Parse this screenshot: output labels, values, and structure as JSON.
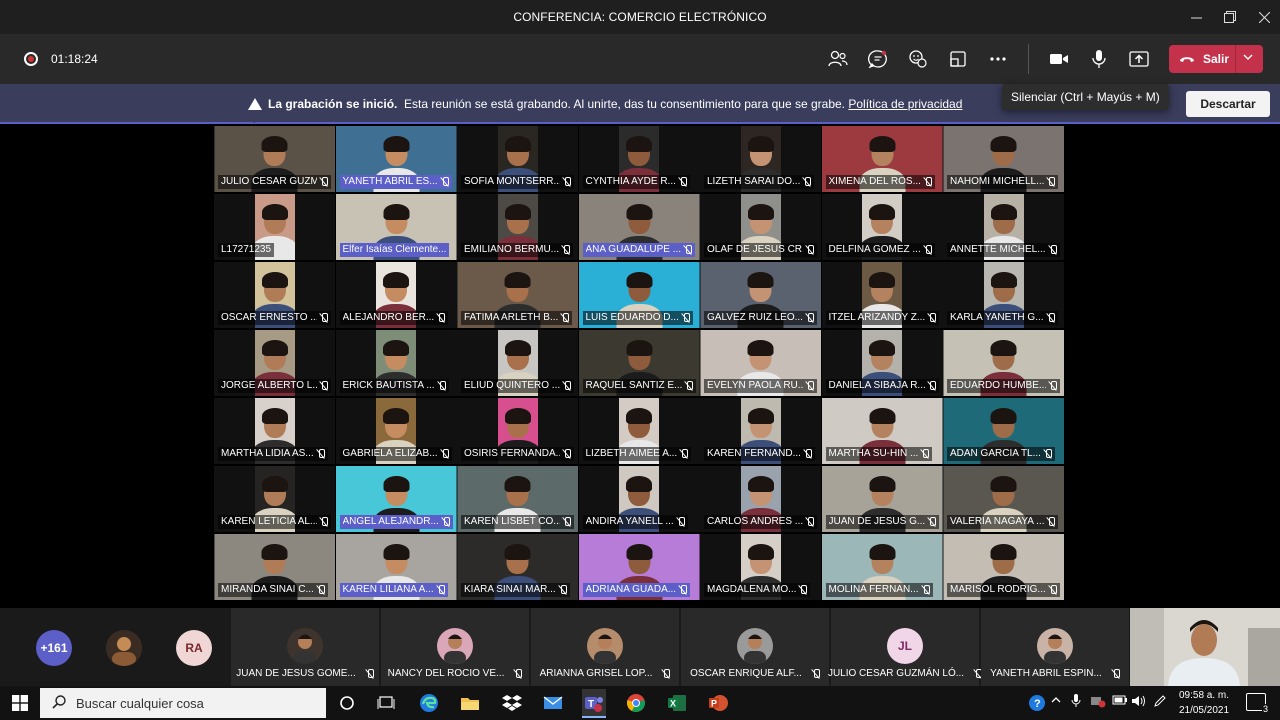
{
  "window": {
    "title": "CONFERENCIA: COMERCIO ELECTRÓNICO",
    "minimize_icon": "minimize-icon",
    "maximize_icon": "restore-icon",
    "close_icon": "close-icon"
  },
  "toolbar": {
    "timer": "01:18:24",
    "recording_icon": "record-icon",
    "icons": [
      "people-icon",
      "chat-icon",
      "reactions-icon",
      "rooms-icon",
      "more-icon",
      "camera-icon",
      "mic-icon",
      "share-icon"
    ],
    "leave_label": "Salir",
    "leave_color": "#c4314b"
  },
  "tooltip": {
    "text": "Silenciar (Ctrl + Mayús + M)"
  },
  "banner": {
    "bold": "La grabación se inició.",
    "text": "Esta reunión se está grabando. Al unirte, das tu consentimiento para que se grabe.",
    "link": "Política de privacidad",
    "dismiss_label": "Descartar",
    "accent": "#5b5fc7"
  },
  "participants": [
    "JULIO CESAR GUZM...",
    "YANETH ABRIL ES...",
    "SOFIA MONTSERR...",
    "CYNTHIA AYDE R...",
    "LIZETH SARAI DO...",
    "XIMENA DEL ROS...",
    "NAHOMI MICHELL...",
    "L17271235",
    "Elfer Isaías Clemente...",
    "EMILIANO BERMU...",
    "ANA GUADALUPE ...",
    "OLAF DE JESUS CR...",
    "DELFINA GOMEZ ...",
    "ANNETTE MICHEL...",
    "OSCAR ERNESTO ...",
    "ALEJANDRO BER...",
    "FATIMA ARLETH B...",
    "LUIS EDUARDO D...",
    "GALVEZ RUIZ LEO...",
    "ITZEL ARIZANDY Z...",
    "KARLA YANETH G...",
    "JORGE ALBERTO L...",
    "ERICK BAUTISTA ...",
    "ELIUD QUINTERO ...",
    "RAQUEL SANTIZ E...",
    "EVELYN PAOLA RU...",
    "DANIELA SIBAJA R...",
    "EDUARDO HUMBE...",
    "MARTHA LIDIA AS...",
    "GABRIELA ELIZAB...",
    "OSIRIS FERNANDA...",
    "LIZBETH AIMEE A...",
    "KAREN FERNAND...",
    "MARTHA SU-HIN ...",
    "ADAN GARCIA TL...",
    "KAREN LETICIA AL...",
    "ANGEL ALEJANDR...",
    "KAREN LISBET CO...",
    "ANDIRA YANELL ...",
    "CARLOS ANDRES ...",
    "JUAN DE JESUS G...",
    "VALERIA NAGAYA ...",
    "MIRANDA SINAI C...",
    "KAREN LILIANA A...",
    "KIARA SINAI MAR...",
    "ADRIANA GUADA...",
    "MAGDALENA MO...",
    "MOLINA FERNAN...",
    "MARISOL RODRIG..."
  ],
  "roster": {
    "overflow_count": "+161",
    "initials_bubble": "RA",
    "people": [
      {
        "name": "JUAN DE JESUS GOME...",
        "initials": ""
      },
      {
        "name": "NANCY DEL ROCIO VE...",
        "initials": ""
      },
      {
        "name": "ARIANNA GRISEL LOP...",
        "initials": ""
      },
      {
        "name": "OSCAR ENRIQUE ALF...",
        "initials": ""
      },
      {
        "name": "JULIO CESAR GUZMÁN LÓ...",
        "initials": "JL"
      },
      {
        "name": "YANETH ABRIL ESPIN...",
        "initials": ""
      }
    ]
  },
  "taskbar": {
    "search_placeholder": "Buscar cualquier cosa",
    "time": "09:58 a. m.",
    "date": "21/05/2021",
    "notification_count": "3",
    "apps": [
      "cortana-icon",
      "taskview-icon",
      "edge-icon",
      "explorer-icon",
      "dropbox-icon",
      "mail-icon",
      "teams-icon",
      "chrome-icon",
      "excel-icon",
      "powerpoint-icon"
    ]
  }
}
